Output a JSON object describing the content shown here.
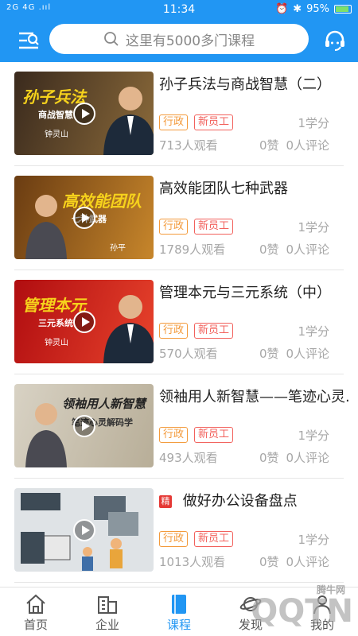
{
  "status_bar": {
    "signal": "2G 4G .ııl",
    "time": "11:34",
    "battery": "95%"
  },
  "header": {
    "search_placeholder": "这里有5000多门课程"
  },
  "courses": [
    {
      "title": "孙子兵法与商战智慧（二）",
      "tags": [
        "行政",
        "新员工"
      ],
      "credit": "1学分",
      "views": "713人观看",
      "likes": "0赞",
      "comments": "0人评论",
      "thumb": {
        "big": "孙子兵法",
        "small": "商战智慧",
        "teacher": "钟灵山",
        "bg1": "#3a2a1d",
        "bg2": "#8b6a3a"
      }
    },
    {
      "title": "高效能团队七种武器",
      "tags": [
        "行政",
        "新员工"
      ],
      "credit": "1学分",
      "views": "1789人观看",
      "likes": "0赞",
      "comments": "0人评论",
      "thumb": {
        "big": "高效能团队",
        "small": "七种武器",
        "teacher": "孙平",
        "bg1": "#6a3c12",
        "bg2": "#c7862b"
      }
    },
    {
      "title": "管理本元与三元系统（中）",
      "tags": [
        "行政",
        "新员工"
      ],
      "credit": "1学分",
      "views": "570人观看",
      "likes": "0赞",
      "comments": "0人评论",
      "thumb": {
        "big": "管理本元",
        "small": "三元系统",
        "teacher": "钟灵山",
        "bg1": "#b00d10",
        "bg2": "#e8432c"
      }
    },
    {
      "title": "领袖用人新智慧——笔迹心灵...",
      "tags": [
        "行政",
        "新员工"
      ],
      "credit": "1学分",
      "views": "493人观看",
      "likes": "0赞",
      "comments": "0人评论",
      "thumb": {
        "big": "领袖用人新智慧",
        "small": "笔迹心灵解码学",
        "teacher": "",
        "bg1": "#d8d2c4",
        "bg2": "#b8ae98"
      }
    },
    {
      "title": "做好办公设备盘点",
      "featured": "精",
      "tags": [
        "行政",
        "新员工"
      ],
      "credit": "1学分",
      "views": "1013人观看",
      "likes": "0赞",
      "comments": "0人评论",
      "thumb": {
        "big": "",
        "small": "",
        "teacher": "",
        "bg1": "#dfe3e6",
        "bg2": "#b9c3c9"
      }
    }
  ],
  "bottom_nav": [
    {
      "label": "首页",
      "icon": "home-icon"
    },
    {
      "label": "企业",
      "icon": "building-icon"
    },
    {
      "label": "课程",
      "icon": "book-icon"
    },
    {
      "label": "发现",
      "icon": "planet-icon"
    },
    {
      "label": "我的",
      "icon": "user-icon"
    }
  ],
  "watermark": {
    "text": "QQTN",
    "sub": "腾牛网"
  },
  "colors": {
    "primary": "#2196f3",
    "tag_orange": "#f39a3b",
    "tag_red": "#f2615c",
    "featured_red": "#e53935"
  }
}
